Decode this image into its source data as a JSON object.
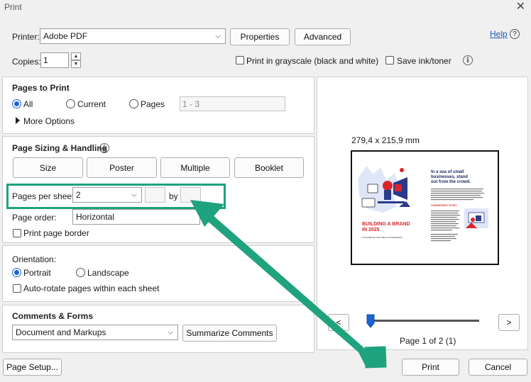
{
  "window": {
    "title": "Print",
    "close_glyph": "✕"
  },
  "printer": {
    "label": "Printer:",
    "selected": "Adobe PDF",
    "properties_label": "Properties",
    "advanced_label": "Advanced",
    "help_label": "Help"
  },
  "copies": {
    "label": "Copies:",
    "value": "1",
    "grayscale_label": "Print in grayscale (black and white)",
    "grayscale_checked": false,
    "save_ink_label": "Save ink/toner",
    "save_ink_checked": false
  },
  "pages_to_print": {
    "heading": "Pages to Print",
    "all_label": "All",
    "current_label": "Current",
    "pages_label": "Pages",
    "pages_value": "1 - 3",
    "more_options_label": "More Options",
    "selected": "All"
  },
  "sizing": {
    "heading": "Page Sizing & Handling",
    "buttons": [
      "Size",
      "Poster",
      "Multiple",
      "Booklet"
    ],
    "pages_per_sheet_label": "Pages per sheet:",
    "pages_per_sheet_value": "2",
    "by_label": "by",
    "page_order_label": "Page order:",
    "page_order_value": "Horizontal",
    "print_border_label": "Print page border"
  },
  "orientation": {
    "heading": "Orientation:",
    "portrait_label": "Portrait",
    "landscape_label": "Landscape",
    "selected": "Portrait",
    "auto_rotate_label": "Auto-rotate pages within each sheet"
  },
  "comments": {
    "heading": "Comments & Forms",
    "selected": "Document and Markups",
    "summarize_label": "Summarize Comments"
  },
  "preview": {
    "dimensions": "279,4 x 215,9 mm",
    "page_indicator": "Page 1 of 2 (1)",
    "next_label": ">",
    "prev_label": "<",
    "slide_progress": 0.03,
    "left_page": {
      "headline": "BUILDING A BRAND IN 2025",
      "subline": "A PLAYBOOK FOR SMALL BUSINESSES"
    },
    "right_page": {
      "headline": "In a sea of small businesses, stand out from the crowd.",
      "subhead": "CONSISTENCY IS KEY"
    }
  },
  "footer": {
    "page_setup_label": "Page Setup...",
    "print_label": "Print",
    "cancel_label": "Cancel"
  },
  "colors": {
    "accent": "#1c64d0",
    "highlight": "#1fa27e",
    "brand_red": "#d8262b"
  }
}
